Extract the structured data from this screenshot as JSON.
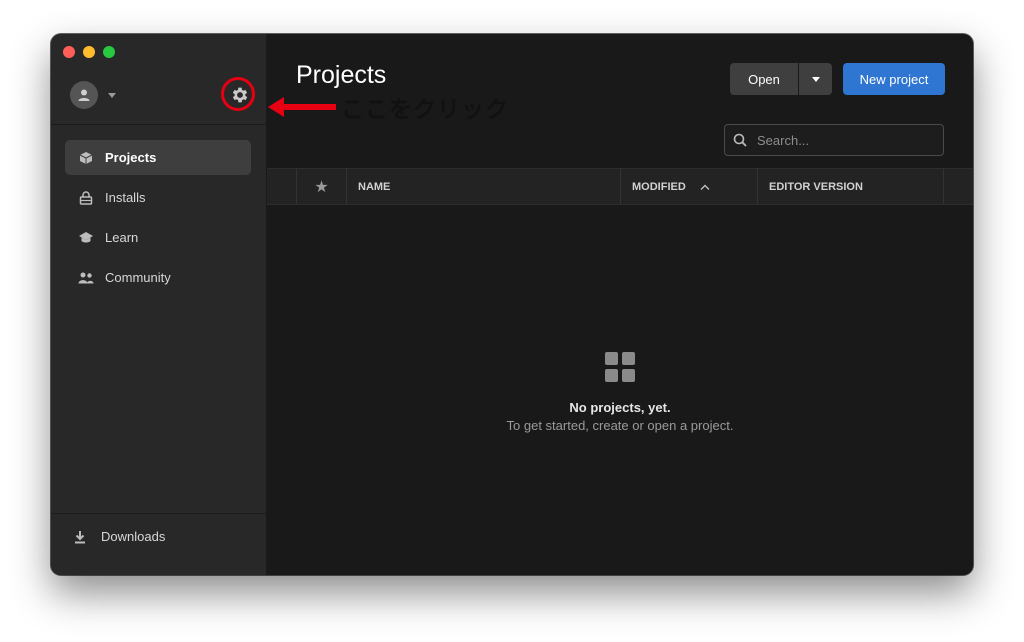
{
  "window": {
    "traffic_lights": [
      "close",
      "minimize",
      "zoom"
    ]
  },
  "sidebar": {
    "account_icon": "user-icon",
    "settings_icon": "gear-icon",
    "items": [
      {
        "label": "Projects",
        "icon": "cube-icon",
        "active": true
      },
      {
        "label": "Installs",
        "icon": "lock-icon",
        "active": false
      },
      {
        "label": "Learn",
        "icon": "graduation-cap-icon",
        "active": false
      },
      {
        "label": "Community",
        "icon": "people-icon",
        "active": false
      }
    ],
    "downloads_label": "Downloads",
    "downloads_icon": "download-icon"
  },
  "header": {
    "title": "Projects",
    "open_label": "Open",
    "new_project_label": "New project",
    "search_placeholder": "Search..."
  },
  "table": {
    "columns": [
      "",
      "★",
      "NAME",
      "MODIFIED",
      "EDITOR VERSION",
      ""
    ],
    "sort_column": "MODIFIED",
    "sort_direction": "ascending"
  },
  "empty_state": {
    "icon": "grid-icon",
    "title": "No projects, yet.",
    "subtitle": "To get started, create or open a project."
  },
  "annotation": {
    "text": "ここをクリック",
    "color": "#e60012"
  },
  "colors": {
    "accent": "#2f76d2",
    "sidebar_bg": "#282828",
    "main_bg": "#191919"
  }
}
